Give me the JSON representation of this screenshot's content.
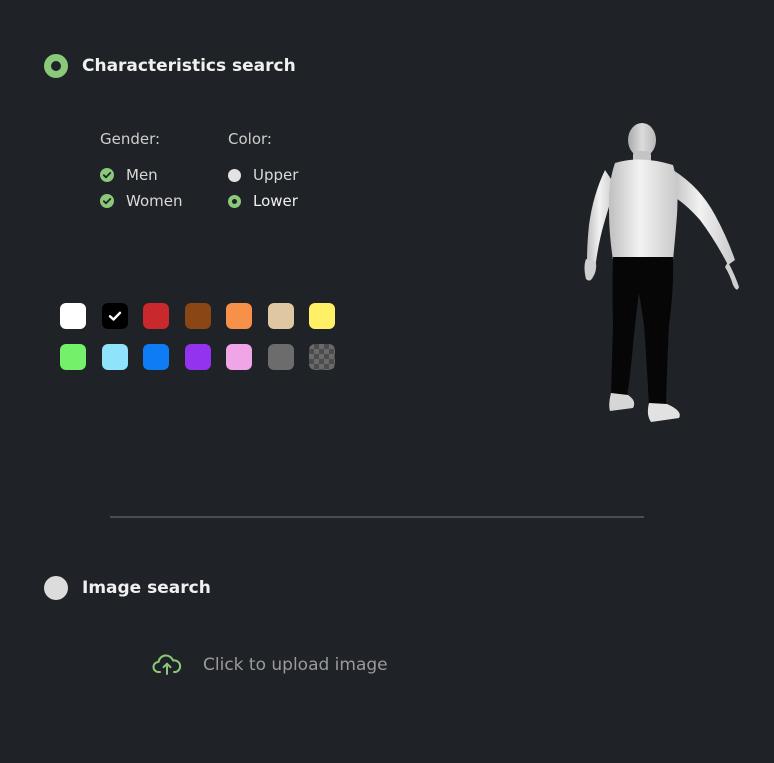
{
  "characteristics_search": {
    "label": "Characteristics search",
    "selected": true
  },
  "gender": {
    "title": "Gender:",
    "options": [
      {
        "label": "Men",
        "checked": true
      },
      {
        "label": "Women",
        "checked": true
      }
    ]
  },
  "color": {
    "title": "Color:",
    "options": [
      {
        "label": "Upper",
        "selected": false
      },
      {
        "label": "Lower",
        "selected": true
      }
    ]
  },
  "swatches": [
    {
      "name": "white",
      "color": "#ffffff",
      "selected": false
    },
    {
      "name": "black",
      "color": "#000000",
      "selected": true
    },
    {
      "name": "red",
      "color": "#c9282d",
      "selected": false
    },
    {
      "name": "brown",
      "color": "#8a4614",
      "selected": false
    },
    {
      "name": "orange",
      "color": "#f7914a",
      "selected": false
    },
    {
      "name": "beige",
      "color": "#dfc7a1",
      "selected": false
    },
    {
      "name": "yellow",
      "color": "#fff066",
      "selected": false
    },
    {
      "name": "green",
      "color": "#74f06a",
      "selected": false
    },
    {
      "name": "light-blue",
      "color": "#8fe3fb",
      "selected": false
    },
    {
      "name": "blue",
      "color": "#0e7df5",
      "selected": false
    },
    {
      "name": "purple",
      "color": "#9433ef",
      "selected": false
    },
    {
      "name": "pink",
      "color": "#f0a5e6",
      "selected": false
    },
    {
      "name": "gray",
      "color": "#6c6c6c",
      "selected": false
    },
    {
      "name": "pattern",
      "color": "checker",
      "selected": false
    }
  ],
  "image_search": {
    "label": "Image search",
    "selected": false
  },
  "upload": {
    "label": "Click to upload image",
    "icon": "cloud-upload-icon"
  },
  "colors": {
    "accent": "#8bc97a",
    "background": "#1f2226"
  }
}
